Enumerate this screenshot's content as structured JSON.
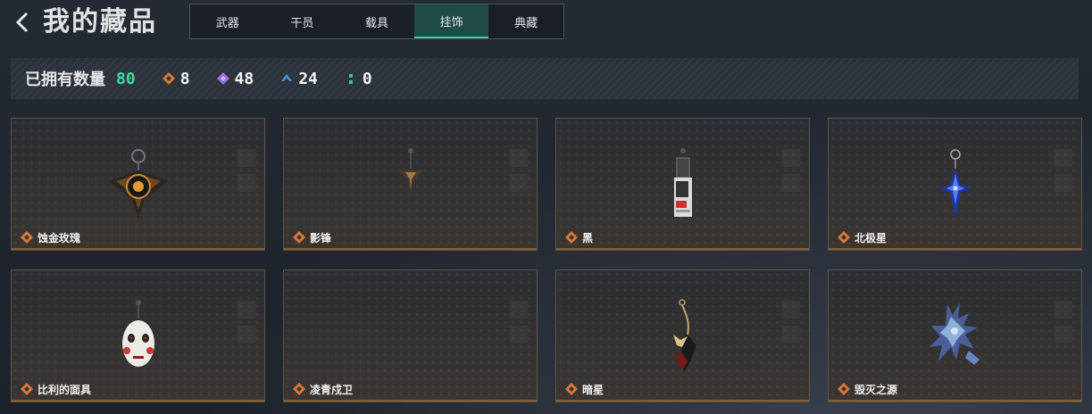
{
  "header": {
    "title": "我的藏品"
  },
  "tabs": [
    {
      "label": "武器",
      "active": false
    },
    {
      "label": "干员",
      "active": false
    },
    {
      "label": "载具",
      "active": false
    },
    {
      "label": "挂饰",
      "active": true
    },
    {
      "label": "典藏",
      "active": false
    }
  ],
  "stats": {
    "label": "已拥有数量",
    "total": "80",
    "tiers": [
      {
        "icon": "orange-diamond-icon",
        "color": "#d9783a",
        "value": "8"
      },
      {
        "icon": "purple-diamond-icon",
        "color": "#9b6fd8",
        "value": "48"
      },
      {
        "icon": "blue-chevron-icon",
        "color": "#4f94d9",
        "value": "24"
      },
      {
        "icon": "green-dots-icon",
        "color": "#3cc48f",
        "value": "0"
      }
    ]
  },
  "items": [
    {
      "name": "蚀金玫瑰",
      "rarity_icon": "orange-diamond-icon"
    },
    {
      "name": "影锋",
      "rarity_icon": "orange-diamond-icon"
    },
    {
      "name": "黑",
      "rarity_icon": "orange-diamond-icon"
    },
    {
      "name": "北极星",
      "rarity_icon": "orange-diamond-icon"
    },
    {
      "name": "比利的面具",
      "rarity_icon": "orange-diamond-icon"
    },
    {
      "name": "凌青戍卫",
      "rarity_icon": "orange-diamond-icon"
    },
    {
      "name": "暗星",
      "rarity_icon": "orange-diamond-icon"
    },
    {
      "name": "毁灭之源",
      "rarity_icon": "orange-diamond-icon"
    }
  ],
  "colors": {
    "accent": "#3cdc9c",
    "rarity_orange": "#d9783a"
  }
}
